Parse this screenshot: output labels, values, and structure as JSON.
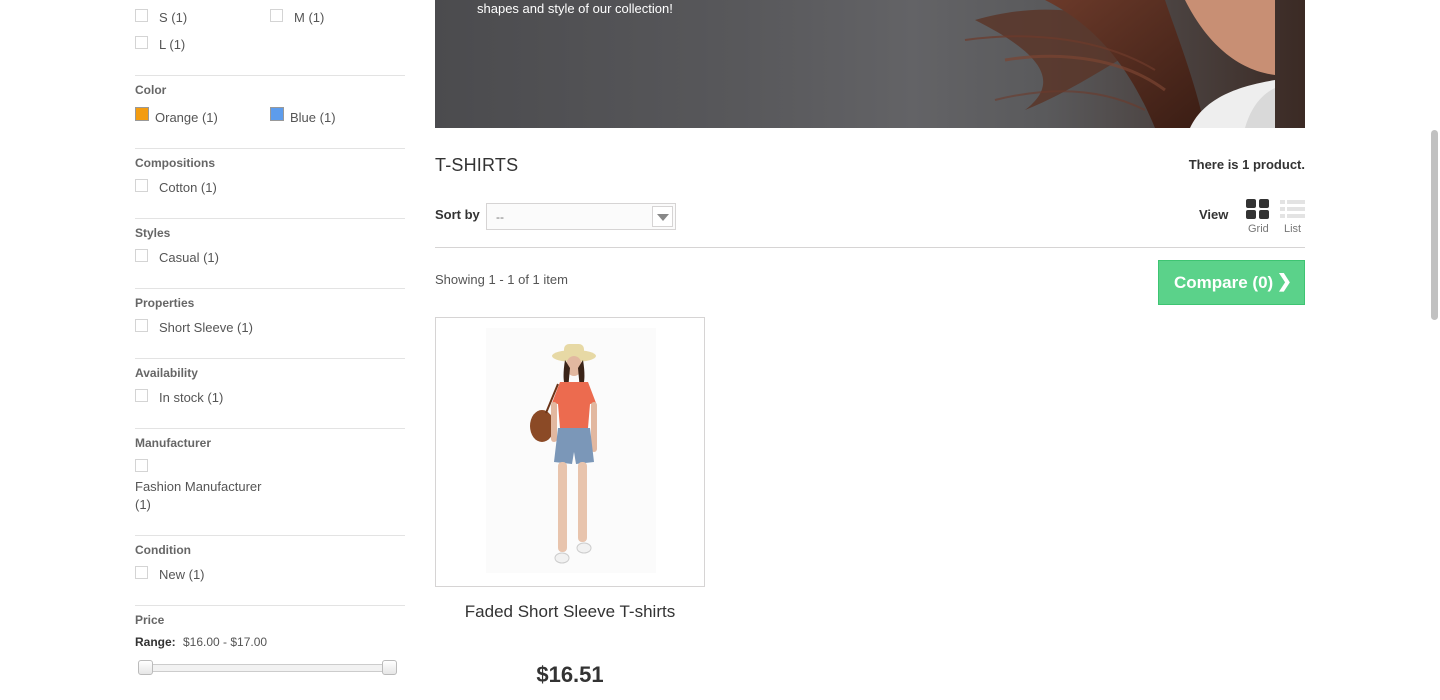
{
  "filters": {
    "size_options": [
      {
        "label": "S (1)"
      },
      {
        "label": "M (1)"
      },
      {
        "label": "L (1)"
      }
    ],
    "color": {
      "heading": "Color",
      "options": [
        {
          "label": "Orange (1)",
          "color": "#f39c11"
        },
        {
          "label": "Blue (1)",
          "color": "#5d9cec"
        }
      ]
    },
    "compositions": {
      "heading": "Compositions",
      "option": "Cotton (1)"
    },
    "styles": {
      "heading": "Styles",
      "option": "Casual (1)"
    },
    "properties": {
      "heading": "Properties",
      "option": "Short Sleeve (1)"
    },
    "availability": {
      "heading": "Availability",
      "option": "In stock (1)"
    },
    "manufacturer": {
      "heading": "Manufacturer",
      "option_line1": "Fashion Manufacturer",
      "option_line2": "(1)"
    },
    "condition": {
      "heading": "Condition",
      "option": "New (1)"
    },
    "price": {
      "heading": "Price",
      "range_label": "Range:",
      "range_value": "$16.00 - $17.00"
    }
  },
  "banner": {
    "text": "shapes and style of our collection!"
  },
  "category": {
    "title": "T-SHIRTS",
    "product_count": "There is 1 product."
  },
  "toolbar": {
    "sort_label": "Sort by",
    "sort_value": "--",
    "view_label": "View",
    "grid_label": "Grid",
    "list_label": "List",
    "showing": "Showing 1 - 1 of 1 item",
    "compare_label": "Compare (0)",
    "compare_color": "#5bd28a"
  },
  "products": [
    {
      "name": "Faded Short Sleeve T-shirts",
      "price": "$16.51"
    }
  ]
}
